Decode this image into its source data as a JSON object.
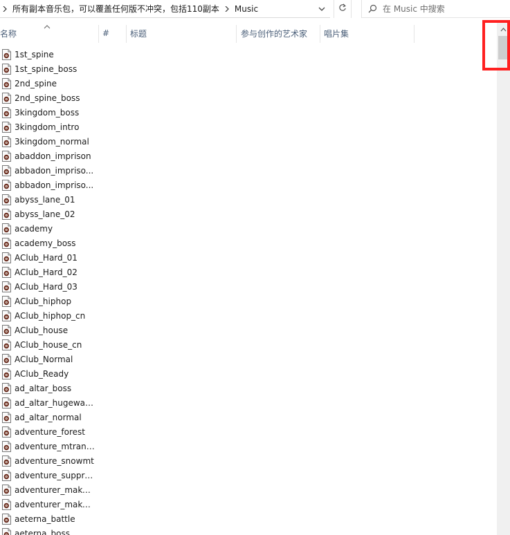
{
  "address_bar": {
    "path": [
      "所有副本音乐包，可以覆盖任何版不冲突，包括110副本",
      "Music"
    ]
  },
  "search": {
    "placeholder": "在 Music 中搜索"
  },
  "columns": {
    "name": "名称",
    "number": "#",
    "title": "标题",
    "artists": "参与创作的艺术家",
    "album": "唱片集"
  },
  "files": [
    "1st_spine",
    "1st_spine_boss",
    "2nd_spine",
    "2nd_spine_boss",
    "3kingdom_boss",
    "3kingdom_intro",
    "3kingdom_normal",
    "abaddon_imprison",
    "abbadon_impriso...",
    "abbadon_impriso...",
    "abyss_lane_01",
    "abyss_lane_02",
    "academy",
    "academy_boss",
    "AClub_Hard_01",
    "AClub_Hard_02",
    "AClub_Hard_03",
    "AClub_hiphop",
    "AClub_hiphop_cn",
    "AClub_house",
    "AClub_house_cn",
    "AClub_Normal",
    "AClub_Ready",
    "ad_altar_boss",
    "ad_altar_hugewave",
    "ad_altar_normal",
    "adventure_forest",
    "adventure_mtrange",
    "adventure_snowmt",
    "adventure_suppre...",
    "adventurer_maker...",
    "adventurer_maker...",
    "aeterna_battle",
    "aeterna_boss"
  ],
  "icons": {
    "file": "audio-file-icon",
    "dropdown": "chevron-down-icon",
    "refresh": "refresh-icon",
    "search": "search-icon",
    "breadcrumb_separator": "chevron-right-icon",
    "sort": "sort-up-icon",
    "scroll_up": "scroll-up-arrow-icon"
  },
  "colors": {
    "header_text": "#4c607a",
    "highlight": "#ff2020",
    "scroll_thumb": "#cdcdcd"
  }
}
